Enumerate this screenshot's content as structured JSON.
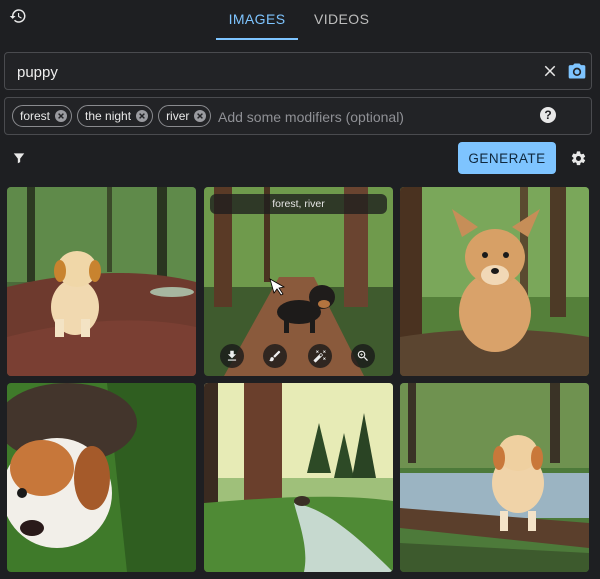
{
  "tabs": [
    {
      "label": "IMAGES",
      "active": true
    },
    {
      "label": "VIDEOS",
      "active": false
    }
  ],
  "search": {
    "value": "puppy",
    "placeholder": ""
  },
  "modifiers": {
    "chips": [
      "forest",
      "the night",
      "river"
    ],
    "placeholder": "Add some modifiers (optional)"
  },
  "toolbar": {
    "generate_label": "GENERATE"
  },
  "gallery": {
    "hovered_caption": "forest, river",
    "actions": [
      "download-icon",
      "brush-icon",
      "magic-wand-icon",
      "zoom-in-icon"
    ]
  },
  "colors": {
    "accent": "#7ec4ff",
    "background": "#1e1f22"
  },
  "icons": [
    "history-icon",
    "clear-icon",
    "camera-icon",
    "help-icon",
    "filter-icon",
    "gear-icon"
  ]
}
